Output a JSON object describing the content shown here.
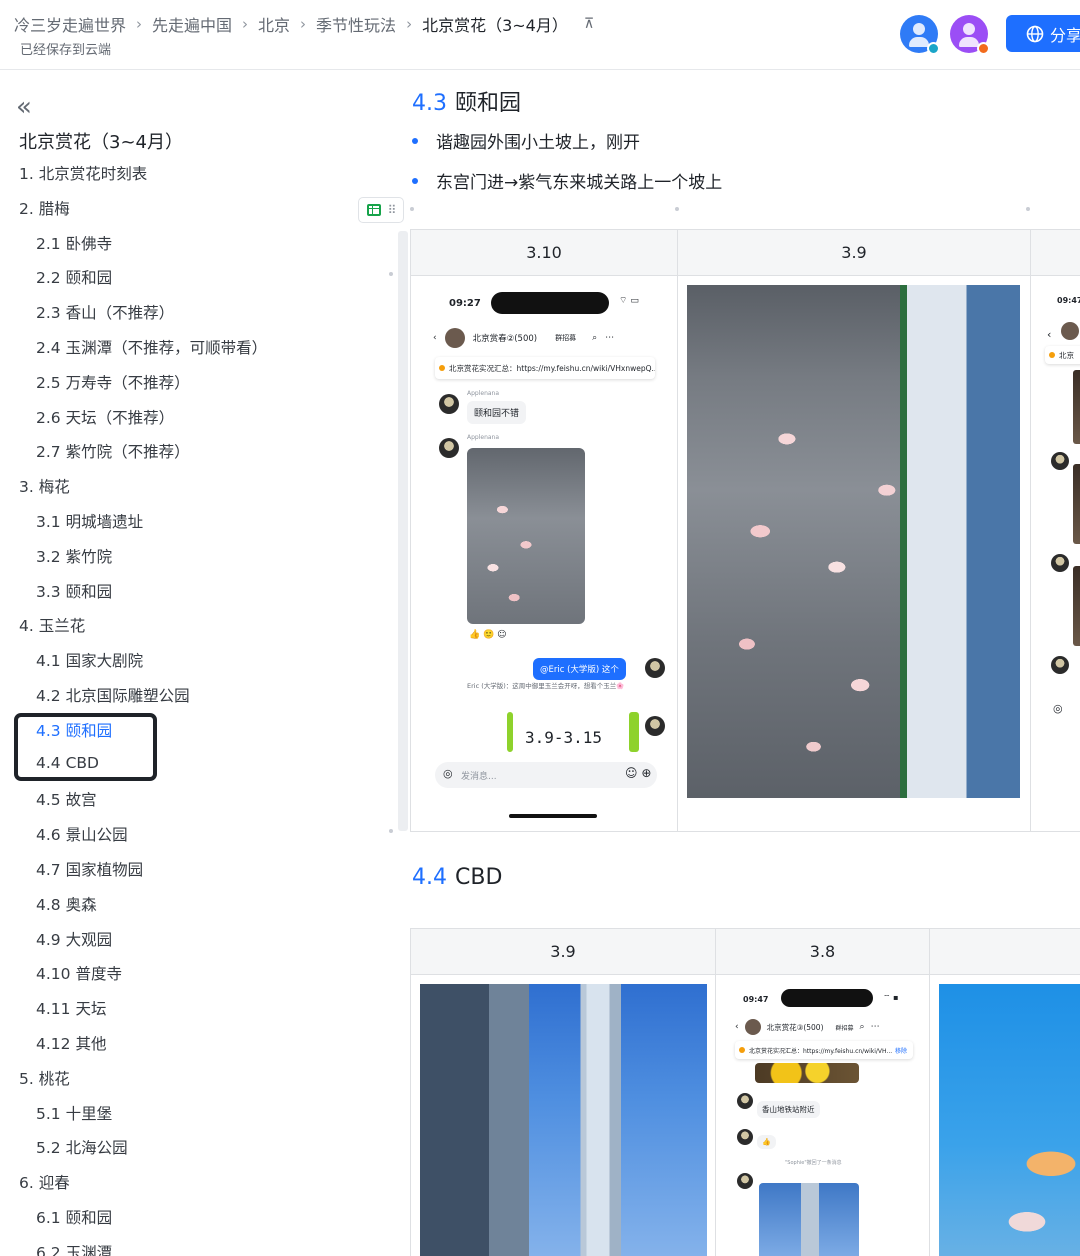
{
  "header": {
    "breadcrumbs": [
      "冷三岁走遍世界",
      "先走遍中国",
      "北京",
      "季节性玩法",
      "北京赏花（3~4月）"
    ],
    "save_status": "已经保存到云端",
    "share_label": "分享",
    "colors": {
      "accent": "#1e6fff",
      "avatar1": "#2f7bf6",
      "avatar2": "#9b4ef5",
      "presence_online": "#1aa5c8",
      "presence_busy": "#f26b1d"
    }
  },
  "toc": {
    "title": "北京赏花（3~4月）",
    "items": [
      {
        "label": "1. 北京赏花时刻表",
        "level": 1
      },
      {
        "label": "2. 腊梅",
        "level": 1
      },
      {
        "label": "2.1 卧佛寺",
        "level": 2
      },
      {
        "label": "2.2 颐和园",
        "level": 2
      },
      {
        "label": "2.3 香山（不推荐）",
        "level": 2
      },
      {
        "label": "2.4 玉渊潭（不推荐，可顺带看）",
        "level": 2
      },
      {
        "label": "2.5 万寿寺（不推荐）",
        "level": 2
      },
      {
        "label": "2.6 天坛（不推荐）",
        "level": 2
      },
      {
        "label": "2.7 紫竹院（不推荐）",
        "level": 2
      },
      {
        "label": "3. 梅花",
        "level": 1
      },
      {
        "label": "3.1 明城墙遗址",
        "level": 2
      },
      {
        "label": "3.2 紫竹院",
        "level": 2
      },
      {
        "label": "3.3 颐和园",
        "level": 2
      },
      {
        "label": "4. 玉兰花",
        "level": 1
      },
      {
        "label": "4.1 国家大剧院",
        "level": 2
      },
      {
        "label": "4.2 北京国际雕塑公园",
        "level": 2
      },
      {
        "label": "4.3 颐和园",
        "level": 2,
        "active": true
      },
      {
        "label": "4.4 CBD",
        "level": 2
      },
      {
        "label": "4.5 故宫",
        "level": 2
      },
      {
        "label": "4.6 景山公园",
        "level": 2
      },
      {
        "label": "4.7 国家植物园",
        "level": 2
      },
      {
        "label": "4.8 奥森",
        "level": 2
      },
      {
        "label": "4.9 大观园",
        "level": 2
      },
      {
        "label": "4.10 普度寺",
        "level": 2
      },
      {
        "label": "4.11 天坛",
        "level": 2
      },
      {
        "label": "4.12 其他",
        "level": 2
      },
      {
        "label": "5. 桃花",
        "level": 1
      },
      {
        "label": "5.1 十里堡",
        "level": 2
      },
      {
        "label": "5.2 北海公园",
        "level": 2
      },
      {
        "label": "6. 迎春",
        "level": 1
      },
      {
        "label": "6.1 颐和园",
        "level": 2
      },
      {
        "label": "6.2 玉渊潭",
        "level": 2
      }
    ]
  },
  "section_43": {
    "num": "4.3",
    "title": "颐和园",
    "bullets": [
      "谐趣园外围小土坡上，刚开",
      "东宫门进→紫气东来城关路上一个坡上"
    ],
    "table_headers": [
      "3.10",
      "3.9"
    ]
  },
  "section_44": {
    "num": "4.4",
    "title": "CBD",
    "table_headers": [
      "3.9",
      "3.8"
    ]
  },
  "chat1": {
    "time": "09:27",
    "group": "北京赏春②(500)",
    "group_btn": "群招募",
    "notice": "北京赏花实况汇总：https://my.feishu.cn/wiki/VHxnwepQ...",
    "sender": "Applenana",
    "msg1": "颐和园不错",
    "mention": "@Eric (大学版) 这个",
    "reply": "Eric (大学版)：这周中御里玉兰会开呀，想看个玉兰🌸",
    "handwriting": "3.9-3.15",
    "input_placeholder": "发消息..."
  },
  "chat2": {
    "time": "09:47",
    "group": "北京赏花③(500)",
    "group_btn": "群招募",
    "notice": "北京赏花实况汇总：https://my.feishu.cn/wiki/VH...",
    "notice_action": "移除",
    "msg1": "香山地铁站附近",
    "recall": "\"Sophie\"撤回了一条消息"
  },
  "chat3": {
    "time": "09:47",
    "notice": "北京"
  }
}
